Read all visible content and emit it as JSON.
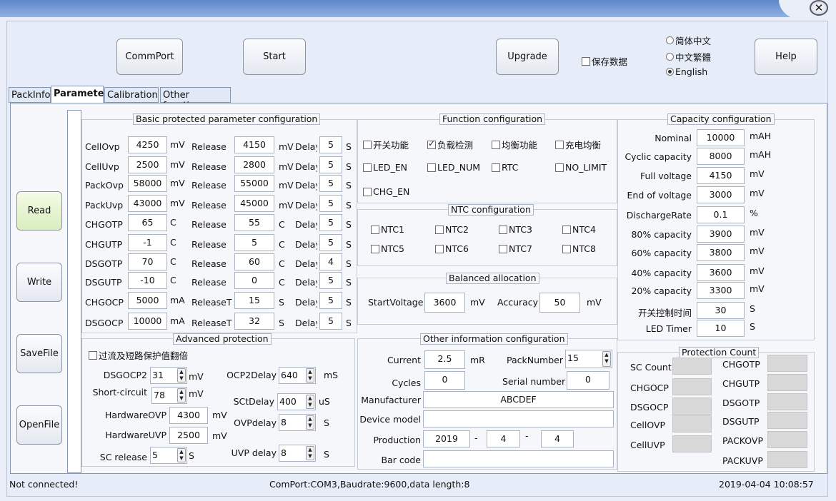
{
  "window": {
    "close_glyph": "✕"
  },
  "toolbar": {
    "commport": "CommPort",
    "start": "Start",
    "upgrade": "Upgrade",
    "help": "Help",
    "save_data": "保存数据"
  },
  "language": {
    "options": [
      "简体中文",
      "中文繁體",
      "English"
    ],
    "selected": "English"
  },
  "tabs": [
    "PackInfo",
    "Parameter",
    "Calibration",
    "Other functions"
  ],
  "active_tab": "Parameter",
  "side_buttons": {
    "read": "Read",
    "write": "Write",
    "savefile": "SaveFile",
    "openfile": "OpenFile"
  },
  "basic": {
    "title": "Basic protected parameter configuration",
    "rows": [
      {
        "name": "CellOvp",
        "value": "4250",
        "unit": "mV",
        "rel_label": "Release",
        "rel_value": "4150",
        "rel_unit": "mV",
        "delay_label": "Delay",
        "delay": "5",
        "delay_unit": "S"
      },
      {
        "name": "CellUvp",
        "value": "2500",
        "unit": "mV",
        "rel_label": "Release",
        "rel_value": "2800",
        "rel_unit": "mV",
        "delay_label": "Delay",
        "delay": "5",
        "delay_unit": "S"
      },
      {
        "name": "PackOvp",
        "value": "58000",
        "unit": "mV",
        "rel_label": "Release",
        "rel_value": "55000",
        "rel_unit": "mV",
        "delay_label": "Delay",
        "delay": "5",
        "delay_unit": "S"
      },
      {
        "name": "PackUvp",
        "value": "43000",
        "unit": "mV",
        "rel_label": "Release",
        "rel_value": "45000",
        "rel_unit": "mV",
        "delay_label": "Delay",
        "delay": "5",
        "delay_unit": "S"
      },
      {
        "name": "CHGOTP",
        "value": "65",
        "unit": "C",
        "rel_label": "Release",
        "rel_value": "55",
        "rel_unit": "C",
        "delay_label": "Delay",
        "delay": "5",
        "delay_unit": "S"
      },
      {
        "name": "CHGUTP",
        "value": "-1",
        "unit": "C",
        "rel_label": "Release",
        "rel_value": "5",
        "rel_unit": "C",
        "delay_label": "Delay",
        "delay": "5",
        "delay_unit": "S"
      },
      {
        "name": "DSGOTP",
        "value": "70",
        "unit": "C",
        "rel_label": "Release",
        "rel_value": "60",
        "rel_unit": "C",
        "delay_label": "Delay",
        "delay": "4",
        "delay_unit": "S"
      },
      {
        "name": "DSGUTP",
        "value": "-10",
        "unit": "C",
        "rel_label": "Release",
        "rel_value": "0",
        "rel_unit": "C",
        "delay_label": "Delay",
        "delay": "5",
        "delay_unit": "S"
      },
      {
        "name": "CHGOCP",
        "value": "5000",
        "unit": "mA",
        "rel_label": "ReleaseTime",
        "rel_value": "15",
        "rel_unit": "S",
        "delay_label": "Delay",
        "delay": "5",
        "delay_unit": "S"
      },
      {
        "name": "DSGOCP",
        "value": "10000",
        "unit": "mA",
        "rel_label": "ReleaseTime",
        "rel_value": "32",
        "rel_unit": "S",
        "delay_label": "Delay",
        "delay": "5",
        "delay_unit": "S"
      }
    ]
  },
  "advanced": {
    "title": "Advanced protection",
    "checkbox": "过流及短路保护值翻倍",
    "dsgocp2": {
      "label": "DSGOCP2",
      "value": "31",
      "unit": "mV"
    },
    "short_circuit": {
      "label": "Short-circuit",
      "value": "78",
      "unit": "mV"
    },
    "hw_ovp": {
      "label": "HardwareOVP",
      "value": "4300",
      "unit": "mV"
    },
    "hw_uvp": {
      "label": "HardwareUVP",
      "value": "2500",
      "unit": "mV"
    },
    "sc_release": {
      "label": "SC release",
      "value": "5",
      "unit": "S"
    },
    "ocp2delay": {
      "label": "OCP2Delay",
      "value": "640",
      "unit": "mS"
    },
    "sctdelay": {
      "label": "SCtDelay",
      "value": "400",
      "unit": "uS"
    },
    "ovpdelay": {
      "label": "OVPdelay",
      "value": "8",
      "unit": "S"
    },
    "uvpdelay": {
      "label": "UVP delay",
      "value": "8",
      "unit": "S"
    }
  },
  "function": {
    "title": "Function configuration",
    "items": [
      {
        "label": "开关功能",
        "checked": false
      },
      {
        "label": "负载检测",
        "checked": true
      },
      {
        "label": "均衡功能",
        "checked": false
      },
      {
        "label": "充电均衡",
        "checked": false
      },
      {
        "label": "LED_EN",
        "checked": false
      },
      {
        "label": "LED_NUM",
        "checked": false
      },
      {
        "label": "RTC",
        "checked": false
      },
      {
        "label": "NO_LIMIT",
        "checked": false
      },
      {
        "label": "CHG_EN",
        "checked": false
      }
    ]
  },
  "ntc": {
    "title": "NTC configuration",
    "items": [
      "NTC1",
      "NTC2",
      "NTC3",
      "NTC4",
      "NTC5",
      "NTC6",
      "NTC7",
      "NTC8"
    ]
  },
  "balanced": {
    "title": "Balanced allocation",
    "start_label": "StartVoltage",
    "start_value": "3600",
    "start_unit": "mV",
    "acc_label": "Accuracy",
    "acc_value": "50",
    "acc_unit": "mV"
  },
  "other": {
    "title": "Other information configuration",
    "current_label": "Current",
    "current_value": "2.5",
    "current_unit": "mR",
    "packnum_label": "PackNumber",
    "packnum_value": "15",
    "cycles_label": "Cycles",
    "cycles_value": "0",
    "serial_label": "Serial number",
    "serial_value": "0",
    "manufacturer_label": "Manufacturer",
    "manufacturer_value": "ABCDEF",
    "device_label": "Device model",
    "device_value": "",
    "production_label": "Production",
    "year": "2019",
    "month": "4",
    "day": "4",
    "dash": "-",
    "barcode_label": "Bar code",
    "barcode_value": ""
  },
  "capacity": {
    "title": "Capacity configuration",
    "rows": [
      {
        "label": "Nominal",
        "value": "10000",
        "unit": "mAH"
      },
      {
        "label": "Cyclic capacity",
        "value": "8000",
        "unit": "mAH"
      },
      {
        "label": "Full voltage",
        "value": "4150",
        "unit": "mV"
      },
      {
        "label": "End of voltage",
        "value": "3000",
        "unit": "mV"
      },
      {
        "label": "DischargeRate",
        "value": "0.1",
        "unit": "%"
      },
      {
        "label": "80% capacity",
        "value": "3900",
        "unit": "mV"
      },
      {
        "label": "60% capacity",
        "value": "3800",
        "unit": "mV"
      },
      {
        "label": "40% capacity",
        "value": "3600",
        "unit": "mV"
      },
      {
        "label": "20% capacity",
        "value": "3300",
        "unit": "mV"
      },
      {
        "label": "开关控制时间",
        "value": "30",
        "unit": "S"
      },
      {
        "label": "LED Timer",
        "value": "10",
        "unit": "S"
      }
    ]
  },
  "protection_count": {
    "title": "Protection Count",
    "left": [
      "SC Count",
      "CHGOCP",
      "DSGOCP",
      "CellOVP",
      "CellUVP"
    ],
    "right": [
      "CHGOTP",
      "CHGUTP",
      "DSGOTP",
      "DSGUTP",
      "PACKOVP",
      "PACKUVP"
    ]
  },
  "status": {
    "connection": "Not connected!",
    "port": "ComPort:COM3,Baudrate:9600,data length:8",
    "datetime": "2019-04-04 10:08:57"
  }
}
